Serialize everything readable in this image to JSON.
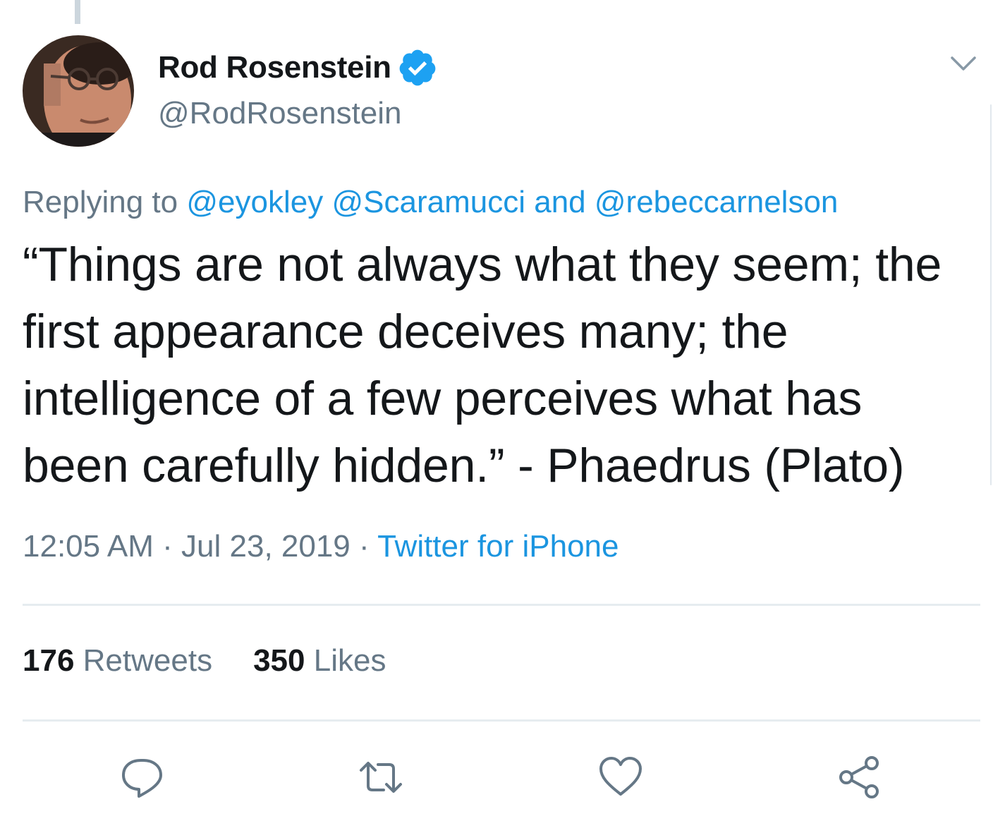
{
  "tweet": {
    "author": {
      "display_name": "Rod Rosenstein",
      "handle": "@RodRosenstein",
      "verified": true
    },
    "reply_context": {
      "prefix": "Replying to",
      "mention_1": "@eyokley",
      "mention_2": "@Scaramucci",
      "joiner": "and",
      "mention_3": "@rebeccarnelson"
    },
    "text": "“Things are not always what they seem; the first appearance deceives many; the intelligence of a few perceives what has been carefully hidden.” - Phaedrus (Plato)",
    "time": "12:05 AM",
    "separator": "·",
    "date": "Jul 23, 2019",
    "source": "Twitter for iPhone",
    "stats": {
      "retweets_count": "176",
      "retweets_label": "Retweets",
      "likes_count": "350",
      "likes_label": "Likes"
    }
  },
  "icons": {
    "verified": "verified-badge-icon",
    "caret": "chevron-down-icon",
    "reply": "reply-icon",
    "retweet": "retweet-icon",
    "like": "heart-icon",
    "share": "share-icon"
  },
  "colors": {
    "link": "#1b95e0",
    "secondary_text": "#657786",
    "primary_text": "#14171a",
    "divider": "#e6ecf0"
  }
}
